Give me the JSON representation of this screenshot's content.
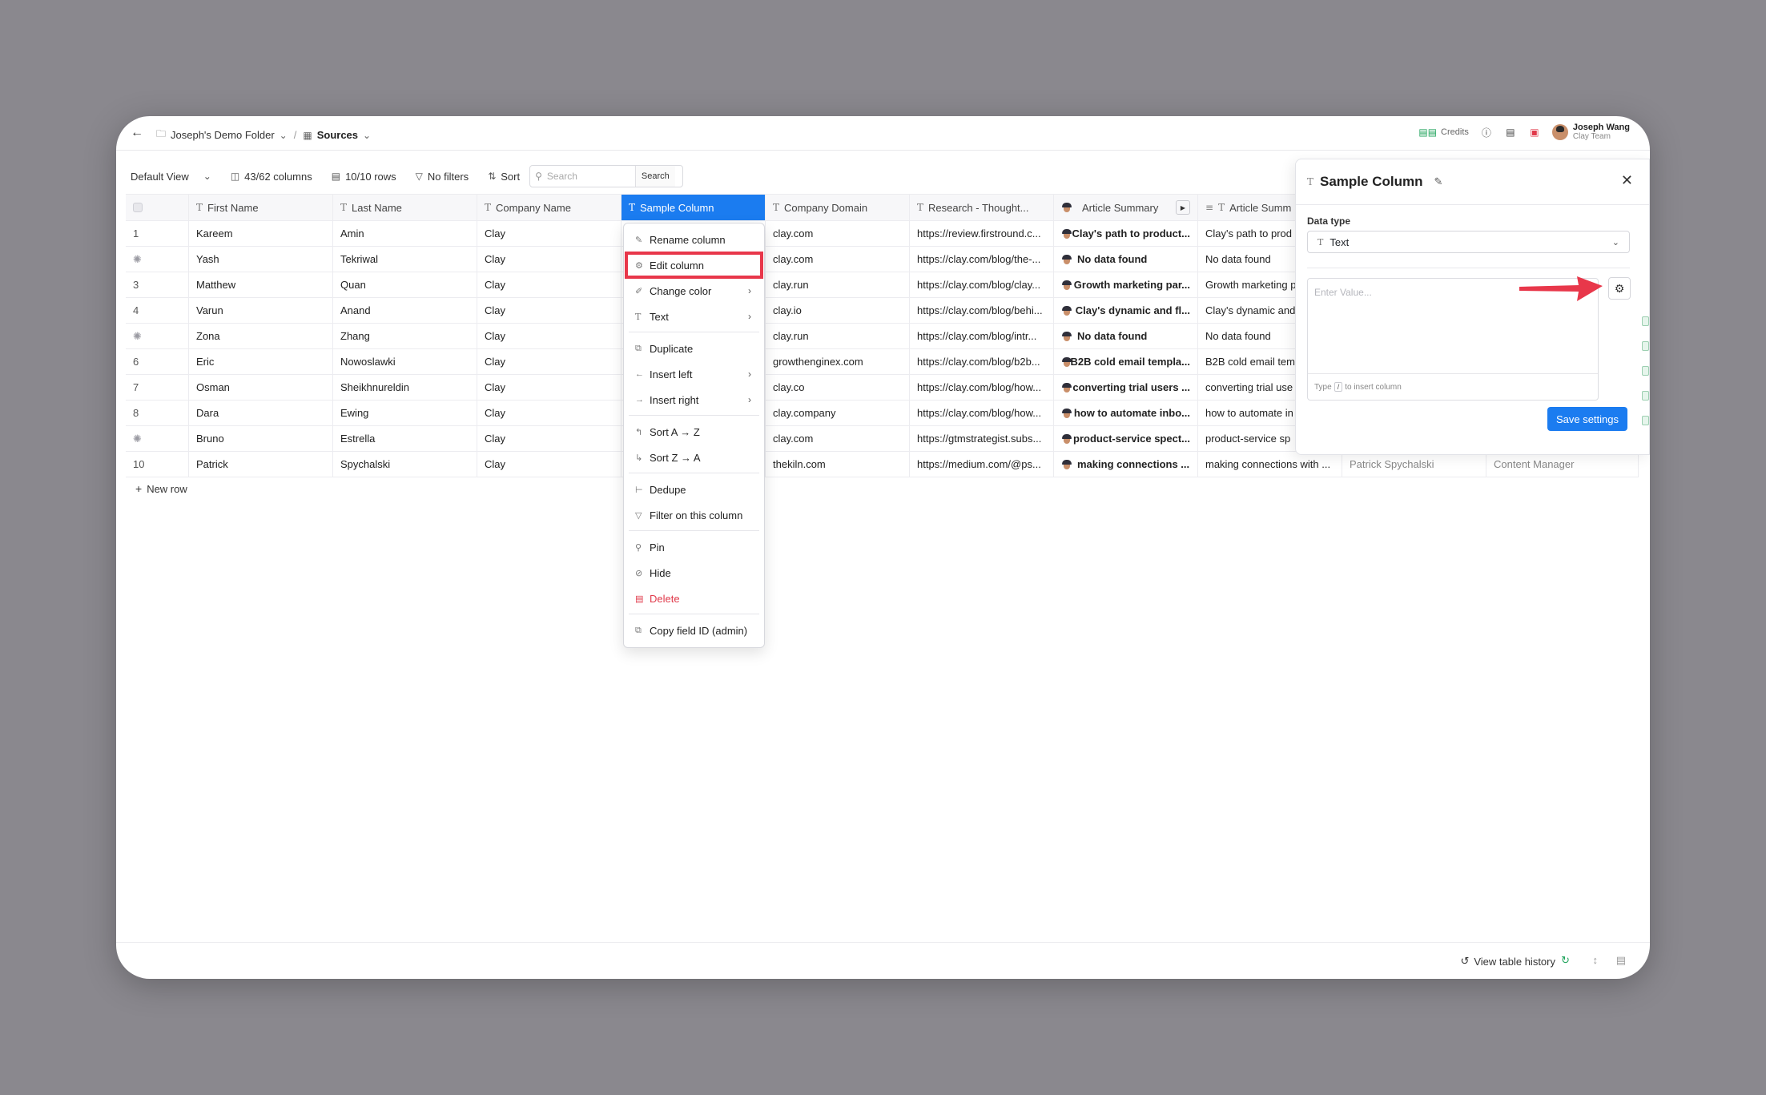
{
  "breadcrumb": {
    "folder": "Joseph's Demo Folder",
    "separator": "/",
    "current": "Sources"
  },
  "topbar": {
    "credits_label": "Credits",
    "user_name": "Joseph Wang",
    "user_team": "Clay Team"
  },
  "toolbar": {
    "view": "Default View",
    "columns": "43/62 columns",
    "rows": "10/10 rows",
    "filters": "No filters",
    "sort": "Sort",
    "search_placeholder": "Search",
    "search_button": "Search"
  },
  "table": {
    "headers": [
      "First Name",
      "Last Name",
      "Company Name",
      "Sample Column",
      "Company Domain",
      "Research - Thought...",
      "Article Summary",
      "Article Summ"
    ],
    "rows": [
      {
        "idx": "1",
        "first": "Kareem",
        "last": "Amin",
        "company": "Clay",
        "sample": "",
        "domain": "clay.com",
        "research": "https://review.firstround.c...",
        "summary": "Clay's path to product...",
        "summary2": "Clay's path to prod",
        "extra1": "",
        "extra2": ""
      },
      {
        "idx": "",
        "first": "Yash",
        "last": "Tekriwal",
        "company": "Clay",
        "sample": "",
        "domain": "clay.com",
        "research": "https://clay.com/blog/the-...",
        "summary": "No data found",
        "summary2": "No data found",
        "extra1": "",
        "extra2": ""
      },
      {
        "idx": "3",
        "first": "Matthew",
        "last": "Quan",
        "company": "Clay",
        "sample": "",
        "domain": "clay.run",
        "research": "https://clay.com/blog/clay...",
        "summary": "Growth marketing par...",
        "summary2": "Growth marketing p",
        "extra1": "",
        "extra2": ""
      },
      {
        "idx": "4",
        "first": "Varun",
        "last": "Anand",
        "company": "Clay",
        "sample": "",
        "domain": "clay.io",
        "research": "https://clay.com/blog/behi...",
        "summary": "Clay's dynamic and fl...",
        "summary2": "Clay's dynamic and",
        "extra1": "",
        "extra2": ""
      },
      {
        "idx": "",
        "first": "Zona",
        "last": "Zhang",
        "company": "Clay",
        "sample": "",
        "domain": "clay.run",
        "research": "https://clay.com/blog/intr...",
        "summary": "No data found",
        "summary2": "No data found",
        "extra1": "",
        "extra2": ""
      },
      {
        "idx": "6",
        "first": "Eric",
        "last": "Nowoslawki",
        "company": "Clay",
        "sample": "",
        "domain": "growthenginex.com",
        "research": "https://clay.com/blog/b2b...",
        "summary": "B2B cold email templa...",
        "summary2": "B2B cold email tem",
        "extra1": "",
        "extra2": ""
      },
      {
        "idx": "7",
        "first": "Osman",
        "last": "Sheikhnureldin",
        "company": "Clay",
        "sample": "",
        "domain": "clay.co",
        "research": "https://clay.com/blog/how...",
        "summary": "converting trial users ...",
        "summary2": "converting trial use",
        "extra1": "",
        "extra2": ""
      },
      {
        "idx": "8",
        "first": "Dara",
        "last": "Ewing",
        "company": "Clay",
        "sample": "",
        "domain": "clay.company",
        "research": "https://clay.com/blog/how...",
        "summary": "how to automate inbo...",
        "summary2": "how to automate in",
        "extra1": "",
        "extra2": ""
      },
      {
        "idx": "",
        "first": "Bruno",
        "last": "Estrella",
        "company": "Clay",
        "sample": "",
        "domain": "clay.com",
        "research": "https://gtmstrategist.subs...",
        "summary": "product-service spect...",
        "summary2": "product-service sp",
        "extra1": "",
        "extra2": ""
      },
      {
        "idx": "10",
        "first": "Patrick",
        "last": "Spychalski",
        "company": "Clay",
        "sample": "",
        "domain": "thekiln.com",
        "research": "https://medium.com/@ps...",
        "summary": "making connections ...",
        "summary2": "making connections with ...",
        "extra1": "Patrick Spychalski",
        "extra2": "Content Manager"
      }
    ],
    "new_row": "New row"
  },
  "context_menu": {
    "rename": "Rename column",
    "edit": "Edit column",
    "change_color": "Change color",
    "text": "Text",
    "duplicate": "Duplicate",
    "insert_left": "Insert left",
    "insert_right": "Insert right",
    "sort_az": "Sort A → Z",
    "sort_za": "Sort Z → A",
    "dedupe": "Dedupe",
    "filter": "Filter on this column",
    "pin": "Pin",
    "hide": "Hide",
    "delete": "Delete",
    "copy_id": "Copy field ID (admin)"
  },
  "panel": {
    "title": "Sample Column",
    "data_type_label": "Data type",
    "data_type_value": "Text",
    "value_placeholder": "Enter Value...",
    "footer_type": "Type",
    "footer_key": "/",
    "footer_hint": "to insert column",
    "save": "Save settings"
  },
  "footer": {
    "history": "View table history"
  },
  "colors": {
    "accent": "#1b7cf0",
    "highlight": "#e8374a",
    "credits": "#1fa35b"
  }
}
